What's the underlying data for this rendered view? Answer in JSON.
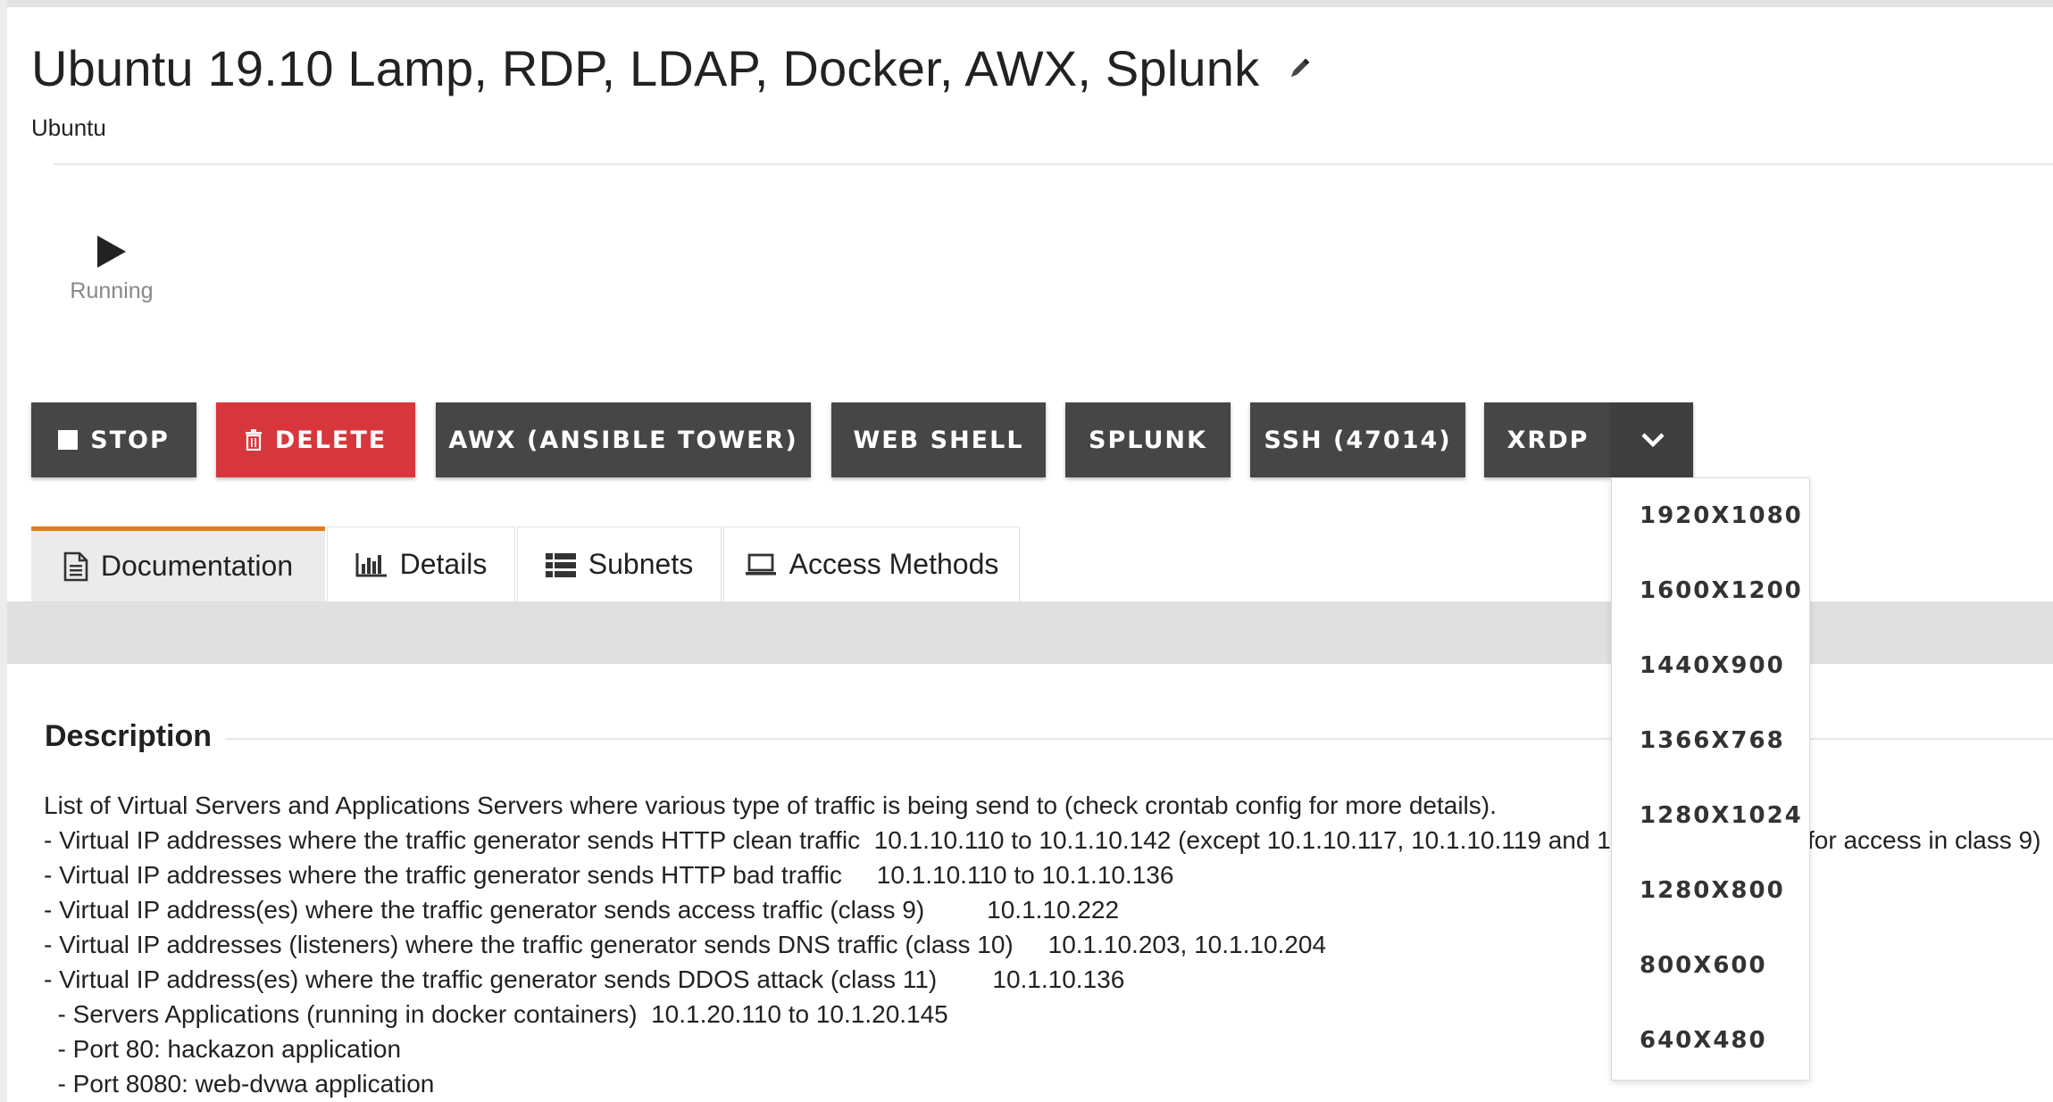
{
  "header": {
    "title": "Ubuntu 19.10 Lamp, RDP, LDAP, Docker, AWX, Splunk",
    "subtitle": "Ubuntu",
    "edit_icon": "pencil-icon"
  },
  "status": {
    "icon": "play-icon",
    "label": "Running"
  },
  "actions": {
    "stop": "STOP",
    "delete": "DELETE",
    "awx": "AWX (ANSIBLE TOWER)",
    "web_shell": "WEB SHELL",
    "splunk": "SPLUNK",
    "ssh": "SSH (47014)",
    "xrdp": "XRDP",
    "delete_color": "#d7373c",
    "button_color": "#464646"
  },
  "xrdp_menu": {
    "options": [
      "1920X1080",
      "1600X1200",
      "1440X900",
      "1366X768",
      "1280X1024",
      "1280X800",
      "800X600",
      "640X480"
    ]
  },
  "tabs": [
    {
      "label": "Documentation",
      "icon": "document-icon",
      "active": true
    },
    {
      "label": "Details",
      "icon": "bar-chart-icon",
      "active": false
    },
    {
      "label": "Subnets",
      "icon": "list-icon",
      "active": false
    },
    {
      "label": "Access Methods",
      "icon": "laptop-icon",
      "active": false
    }
  ],
  "accent_color": "#e07c1c",
  "description": {
    "heading": "Description",
    "lines": [
      "List of Virtual Servers and Applications Servers where various type of traffic is being send to (check crontab config for more details).",
      "- Virtual IP addresses where the traffic generator sends HTTP clean traffic  10.1.10.110 to 10.1.10.142 (except 10.1.10.117, 10.1.10.119 and 1",
      "- Virtual IP addresses where the traffic generator sends HTTP bad traffic     10.1.10.110 to 10.1.10.136",
      "- Virtual IP address(es) where the traffic generator sends access traffic (class 9)         10.1.10.222",
      "- Virtual IP addresses (listeners) where the traffic generator sends DNS traffic (class 10)     10.1.10.203, 10.1.10.204",
      "- Virtual IP address(es) where the traffic generator sends DDOS attack (class 11)        10.1.10.136",
      "  - Servers Applications (running in docker containers)  10.1.20.110 to 10.1.20.145",
      "  - Port 80: hackazon application",
      "  - Port 8080: web-dvwa application"
    ],
    "line2_tail": "for access in class 9)"
  }
}
